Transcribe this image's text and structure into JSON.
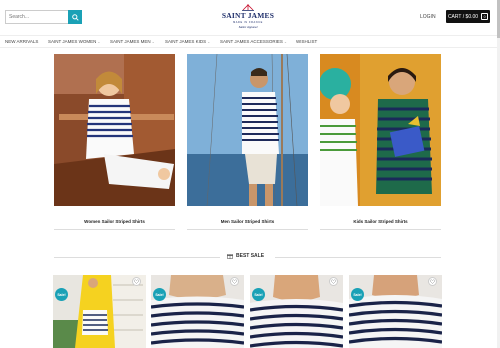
{
  "header": {
    "search_placeholder": "Search...",
    "logo_main": "SAINT JAMES",
    "logo_sub": "MADE IN FRANCE",
    "logo_sub2": "Sailor Apparel",
    "login_label": "LOGIN",
    "cart_label": "CART / $0.00",
    "cart_count": "0"
  },
  "nav": {
    "items": [
      {
        "label": "NEW ARRIVALS",
        "dropdown": false
      },
      {
        "label": "SAINT JAMES WOMEN",
        "dropdown": true
      },
      {
        "label": "SAINT JAMES MEN",
        "dropdown": true
      },
      {
        "label": "SAINT JAMES KIDS",
        "dropdown": true
      },
      {
        "label": "SAINT JAMES ACCESSORIES",
        "dropdown": true
      },
      {
        "label": "WISHLIST",
        "dropdown": false
      }
    ]
  },
  "categories": [
    {
      "caption": "Women Sailor Striped Shirts"
    },
    {
      "caption": "Men Sailor Striped Shirts"
    },
    {
      "caption": "Kids Sailor Striped Shirts"
    }
  ],
  "best_sale": {
    "title": "BEST SALE"
  },
  "products": [
    {
      "badge": "Sale!"
    },
    {
      "badge": "Sale!"
    },
    {
      "badge": "Sale!"
    },
    {
      "badge": "Sale!"
    }
  ],
  "colors": {
    "accent": "#1aa1b6",
    "brand": "#1f2f6b",
    "cart_bg": "#111111"
  }
}
